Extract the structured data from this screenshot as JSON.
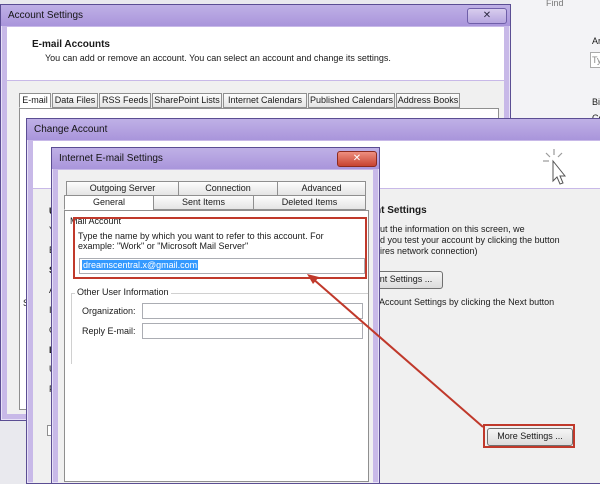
{
  "background": {
    "find_label": "Find",
    "right_fragments": [
      "Ar",
      "Ty",
      "Bi",
      "Co"
    ]
  },
  "account_settings": {
    "title": "Account Settings",
    "heading": "E-mail Accounts",
    "description": "You can add or remove an account. You can select an account and change its settings.",
    "tabs": [
      "E-mail",
      "Data Files",
      "RSS Feeds",
      "SharePoint Lists",
      "Internet Calendars",
      "Published Calendars",
      "Address Books"
    ],
    "left_letter": "S"
  },
  "change_account": {
    "title": "Change Account",
    "left_fragments": [
      "U",
      "Y",
      "E",
      "S",
      "A",
      "I",
      "C",
      "L",
      "U",
      "P"
    ],
    "section_title": "nt Settings",
    "info_lines": [
      "ut the information on this screen, we",
      "d you test your account by clicking the button",
      "ires network connection)"
    ],
    "test_button": "nt Settings ...",
    "next_text": "Account Settings by clicking the Next button",
    "more_settings_button": "More Settings ..."
  },
  "internet_email": {
    "title": "Internet E-mail Settings",
    "tabs_row1": [
      "Outgoing Server",
      "Connection",
      "Advanced"
    ],
    "tabs_row2": [
      "General",
      "Sent Items",
      "Deleted Items"
    ],
    "mail_account_label": "Mail Account",
    "mail_account_help": "Type the name by which you want to refer to this account. For example: \"Work\" or \"Microsoft Mail Server\"",
    "account_name_value": "dreamscentral.x@gmail.com",
    "other_user_label": "Other User Information",
    "organization_label": "Organization:",
    "reply_email_label": "Reply E-mail:"
  }
}
